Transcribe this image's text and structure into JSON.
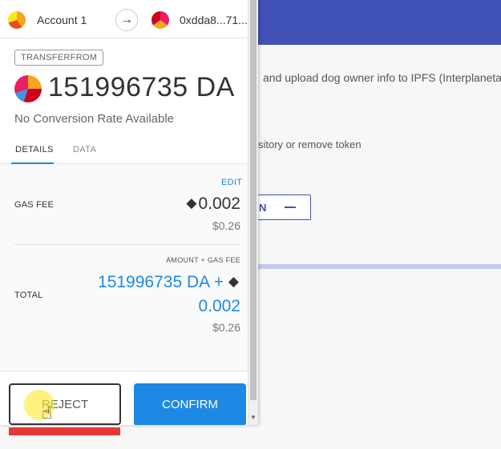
{
  "background": {
    "description_line1": "and upload dog owner info to IPFS (Interplanetary",
    "description_line2": "sitory or remove token",
    "button_partial_label": "N",
    "button_dash": "—"
  },
  "popup": {
    "from_account": "Account 1",
    "arrow": "→",
    "to_address": "0xdda8...71...",
    "method": "TRANSFERFROM",
    "amount": "151996735 DA",
    "conversion": "No Conversion Rate Available",
    "tabs": [
      {
        "label": "DETAILS",
        "active": true
      },
      {
        "label": "DATA",
        "active": false
      }
    ],
    "edit_label": "EDIT",
    "gas_fee_label": "GAS FEE",
    "gas_fee_eth_symbol": "◆",
    "gas_fee_value": "0.002",
    "gas_fee_usd": "$0.26",
    "amount_gas_label": "AMOUNT + GAS FEE",
    "total_label": "TOTAL",
    "total_amount": "151996735 DA +",
    "total_eth_symbol": "◆",
    "total_eth_value": "0.002",
    "total_usd": "$0.26",
    "reject_label": "REJECT",
    "confirm_label": "CONFIRM"
  },
  "colors": {
    "header_blue": "#3f51b5",
    "accent_blue": "#1e88e5",
    "reject_underline": "#e53935"
  }
}
